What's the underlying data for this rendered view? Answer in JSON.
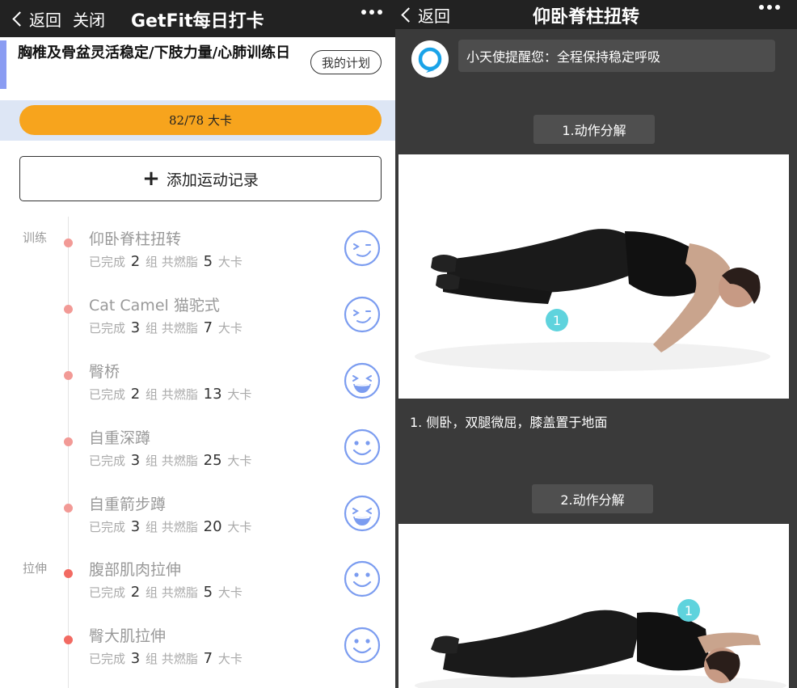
{
  "left": {
    "nav": {
      "back_label": "返回",
      "close_label": "关闭",
      "title": "GetFit每日打卡"
    },
    "plan": {
      "title": "胸椎及骨盆灵活稳定/下肢力量/心肺训练日",
      "my_plan_label": "我的计划"
    },
    "progress": {
      "text": "82/78 大卡",
      "fraction": 1.0
    },
    "add_button_label": "添加运动记录",
    "sections": [
      "训练",
      "拉伸"
    ],
    "exercise_stat_words": {
      "completed": "已完成",
      "sets": "组",
      "burned": "共燃脂",
      "unit": "大卡"
    },
    "exercises": [
      {
        "name": "仰卧脊柱扭转",
        "sets": "2",
        "kcal": "5",
        "face": "wink-face-icon"
      },
      {
        "name": "Cat Camel 猫驼式",
        "sets": "3",
        "kcal": "7",
        "face": "wink-face-icon"
      },
      {
        "name": "臀桥",
        "sets": "2",
        "kcal": "13",
        "face": "grin-face-icon"
      },
      {
        "name": "自重深蹲",
        "sets": "3",
        "kcal": "25",
        "face": "smile-face-icon"
      },
      {
        "name": "自重箭步蹲",
        "sets": "3",
        "kcal": "20",
        "face": "grin-face-icon"
      },
      {
        "name": "腹部肌肉拉伸",
        "sets": "2",
        "kcal": "5",
        "face": "smile-face-icon"
      },
      {
        "name": "臀大肌拉伸",
        "sets": "3",
        "kcal": "7",
        "face": "smile-face-icon"
      }
    ]
  },
  "right": {
    "nav": {
      "back_label": "返回",
      "title": "仰卧脊柱扭转"
    },
    "reminder": "小天使提醒您：全程保持稳定呼吸",
    "steps": [
      {
        "label": "1.动作分解",
        "marker": "1",
        "desc": "1. 侧卧，双腿微屈，膝盖置于地面"
      },
      {
        "label": "2.动作分解",
        "marker": "1",
        "desc": ""
      }
    ]
  },
  "colors": {
    "accent_orange": "#f7a41d",
    "face_blue": "#7b9cf0",
    "dot_red": "#f26a62",
    "plan_accent": "#8a9cf2",
    "marker_teal": "#5fd3dd"
  }
}
